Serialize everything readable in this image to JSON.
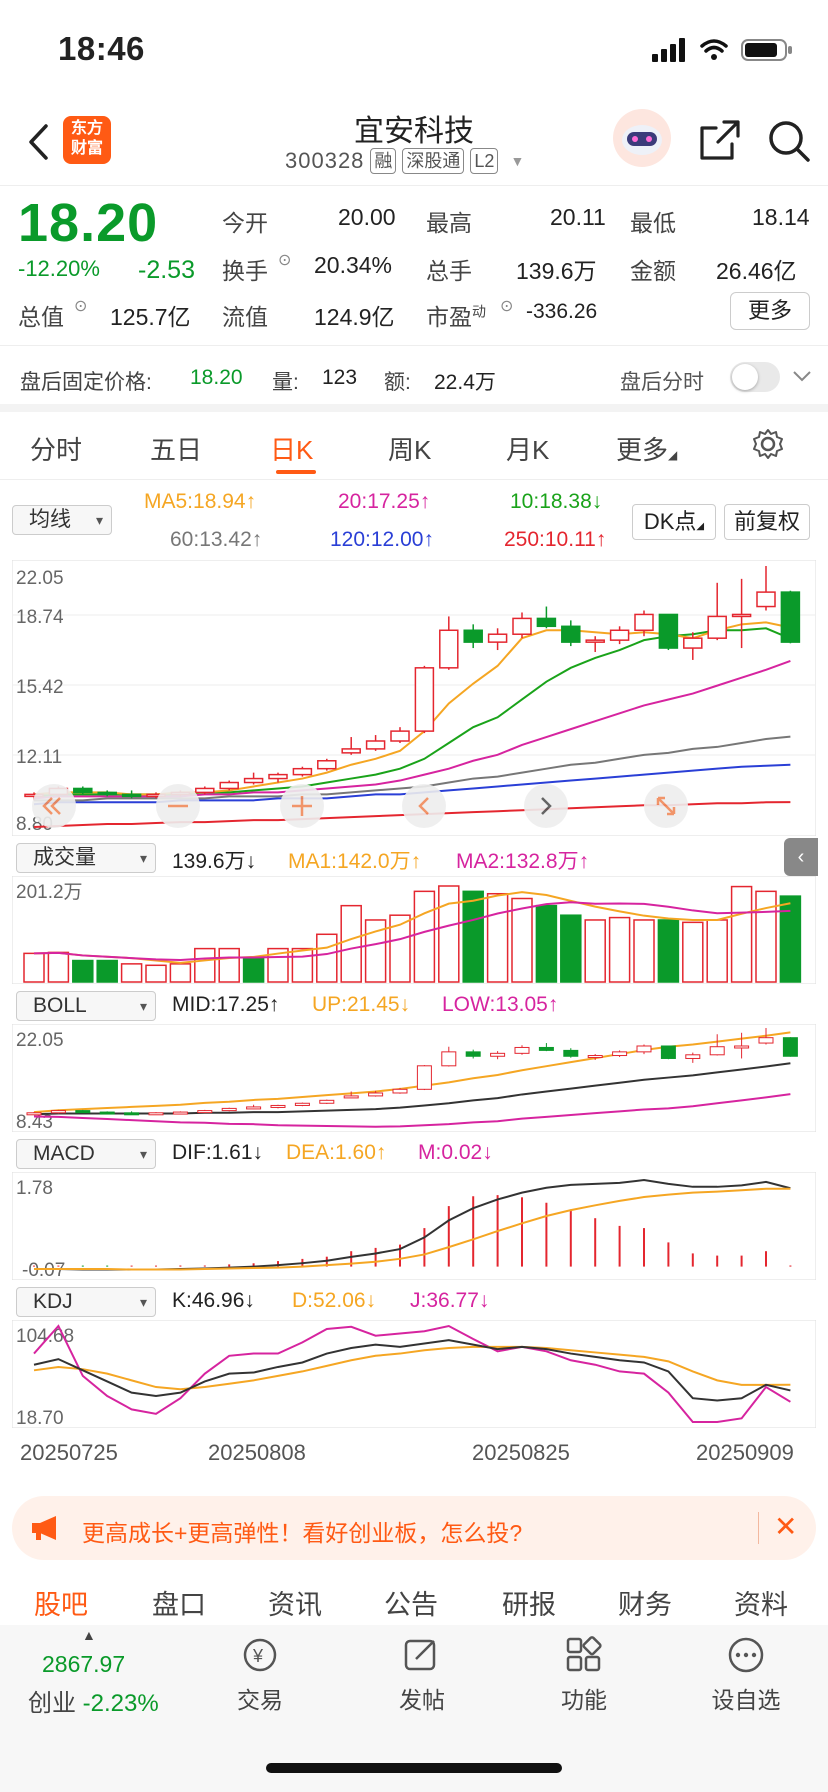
{
  "status": {
    "time": "18:46"
  },
  "header": {
    "title": "宜安科技",
    "code": "300328",
    "tags": [
      "融",
      "深股通",
      "L2"
    ],
    "logo_text": [
      "东方",
      "财富"
    ]
  },
  "quote": {
    "price": "18.20",
    "change_pct": "-12.20%",
    "change": "-2.53",
    "open_label": "今开",
    "open": "20.00",
    "high_label": "最高",
    "high": "20.11",
    "low_label": "最低",
    "low": "18.14",
    "turnover_label": "换手",
    "turnover": "20.34%",
    "volume_label": "总手",
    "volume": "139.6万",
    "amount_label": "金额",
    "amount": "26.46亿",
    "mcap_label": "总值",
    "mcap": "125.7亿",
    "float_label": "流值",
    "float": "124.9亿",
    "pe_label": "市盈",
    "pe_sup": "动",
    "pe": "-336.26",
    "more_label": "更多"
  },
  "after_hours": {
    "label": "盘后固定价格:",
    "price": "18.20",
    "vol_label": "量:",
    "vol": "123",
    "amt_label": "额:",
    "amt": "22.4万",
    "toggle_label": "盘后分时",
    "toggle_on": false
  },
  "tabs": [
    "分时",
    "五日",
    "日K",
    "周K",
    "月K",
    "更多"
  ],
  "active_tab": "日K",
  "ma": {
    "select": "均线",
    "ma5": "MA5:18.94",
    "ma20": "20:17.25",
    "ma10": "10:18.38",
    "ma60": "60:13.42",
    "ma120": "120:12.00",
    "ma250": "250:10.11",
    "dk": "DK点",
    "fq": "前复权",
    "colors": {
      "ma5": "#f5a623",
      "ma10": "#1aa31a",
      "ma20": "#d6249f",
      "ma60": "#777777",
      "ma120": "#2a3fd6",
      "ma250": "#e4262f"
    }
  },
  "k_axis": {
    "y1": "22.05",
    "y2": "18.74",
    "y3": "15.42",
    "y4": "12.11",
    "y5": "8.80"
  },
  "volume": {
    "select": "成交量",
    "total": "139.6万",
    "ma1": "MA1:142.0万",
    "ma2": "MA2:132.8万",
    "ymax": "201.2万"
  },
  "boll": {
    "select": "BOLL",
    "mid": "MID:17.25",
    "up": "UP:21.45",
    "low": "LOW:13.05",
    "ymax": "22.05",
    "ymin": "8.43"
  },
  "macd": {
    "select": "MACD",
    "dif": "DIF:1.61",
    "dea": "DEA:1.60",
    "m": "M:0.02",
    "ymax": "1.78",
    "ymin": "-0.07"
  },
  "kdj": {
    "select": "KDJ",
    "k": "K:46.96",
    "d": "D:52.06",
    "j": "J:36.77",
    "ymax": "104.68",
    "ymin": "18.70"
  },
  "dates": [
    "20250725",
    "20250808",
    "20250825",
    "20250909"
  ],
  "chart_data": {
    "type": "candlestick",
    "ohlc": [
      [
        10.4,
        10.6,
        10.2,
        10.5
      ],
      [
        10.5,
        10.9,
        10.4,
        10.8
      ],
      [
        10.8,
        10.9,
        10.5,
        10.6
      ],
      [
        10.6,
        10.7,
        10.4,
        10.5
      ],
      [
        10.5,
        10.7,
        10.3,
        10.4
      ],
      [
        10.4,
        10.6,
        10.3,
        10.5
      ],
      [
        10.5,
        10.7,
        10.4,
        10.6
      ],
      [
        10.6,
        10.9,
        10.5,
        10.8
      ],
      [
        10.8,
        11.2,
        10.7,
        11.1
      ],
      [
        11.1,
        11.6,
        11.0,
        11.3
      ],
      [
        11.3,
        11.6,
        11.1,
        11.5
      ],
      [
        11.5,
        11.9,
        11.4,
        11.8
      ],
      [
        11.8,
        12.3,
        11.7,
        12.2
      ],
      [
        12.6,
        13.4,
        12.5,
        12.8
      ],
      [
        12.8,
        13.5,
        12.7,
        13.2
      ],
      [
        13.2,
        13.9,
        13.1,
        13.7
      ],
      [
        13.7,
        17.0,
        13.6,
        16.9
      ],
      [
        16.9,
        19.5,
        16.8,
        18.8
      ],
      [
        18.8,
        19.1,
        17.9,
        18.2
      ],
      [
        18.2,
        18.9,
        17.8,
        18.6
      ],
      [
        18.6,
        19.7,
        18.4,
        19.4
      ],
      [
        19.4,
        20.0,
        18.9,
        19.0
      ],
      [
        19.0,
        19.3,
        18.0,
        18.2
      ],
      [
        18.2,
        18.5,
        17.7,
        18.3
      ],
      [
        18.3,
        19.0,
        18.1,
        18.8
      ],
      [
        18.8,
        19.8,
        18.5,
        19.6
      ],
      [
        19.6,
        19.6,
        17.8,
        17.9
      ],
      [
        17.9,
        18.7,
        17.3,
        18.4
      ],
      [
        18.4,
        21.2,
        18.3,
        19.5
      ],
      [
        19.5,
        21.4,
        17.9,
        19.6
      ],
      [
        20.0,
        22.05,
        19.8,
        20.73
      ],
      [
        20.73,
        20.8,
        18.14,
        18.2
      ]
    ],
    "ma5": [
      10.5,
      10.6,
      10.6,
      10.6,
      10.5,
      10.5,
      10.6,
      10.6,
      10.7,
      10.9,
      11.1,
      11.3,
      11.6,
      12.0,
      12.3,
      12.7,
      13.7,
      15.1,
      16.1,
      17.0,
      18.4,
      18.8,
      18.8,
      18.7,
      18.6,
      18.7,
      18.6,
      18.4,
      18.8,
      19.1,
      19.2,
      18.94
    ],
    "ma10": [
      10.4,
      10.5,
      10.5,
      10.5,
      10.5,
      10.5,
      10.5,
      10.6,
      10.6,
      10.7,
      10.8,
      10.9,
      11.1,
      11.3,
      11.5,
      11.8,
      12.3,
      13.1,
      13.9,
      14.4,
      15.3,
      16.2,
      16.9,
      17.4,
      17.8,
      18.3,
      18.5,
      18.6,
      18.8,
      18.8,
      18.9,
      18.38
    ],
    "ma20": [
      10.3,
      10.4,
      10.4,
      10.4,
      10.4,
      10.4,
      10.4,
      10.5,
      10.5,
      10.6,
      10.6,
      10.7,
      10.8,
      10.9,
      11.0,
      11.2,
      11.5,
      11.8,
      12.2,
      12.5,
      13.0,
      13.4,
      13.8,
      14.2,
      14.6,
      15.0,
      15.3,
      15.6,
      16.0,
      16.4,
      16.8,
      17.25
    ],
    "ma60": [
      10.2,
      10.2,
      10.2,
      10.3,
      10.3,
      10.3,
      10.3,
      10.3,
      10.4,
      10.4,
      10.4,
      10.5,
      10.5,
      10.6,
      10.7,
      10.8,
      10.9,
      11.1,
      11.3,
      11.4,
      11.6,
      11.8,
      12.0,
      12.1,
      12.3,
      12.5,
      12.6,
      12.8,
      12.9,
      13.1,
      13.3,
      13.42
    ],
    "ma120": [
      10.0,
      10.1,
      10.1,
      10.1,
      10.1,
      10.1,
      10.2,
      10.2,
      10.2,
      10.2,
      10.3,
      10.3,
      10.3,
      10.4,
      10.5,
      10.5,
      10.6,
      10.7,
      10.8,
      10.9,
      11.0,
      11.1,
      11.2,
      11.3,
      11.4,
      11.5,
      11.6,
      11.7,
      11.8,
      11.9,
      11.95,
      12.0
    ],
    "ma250": [
      8.85,
      8.9,
      8.95,
      9.0,
      9.0,
      9.05,
      9.1,
      9.1,
      9.15,
      9.2,
      9.2,
      9.25,
      9.3,
      9.35,
      9.4,
      9.45,
      9.5,
      9.55,
      9.6,
      9.65,
      9.7,
      9.75,
      9.8,
      9.85,
      9.9,
      9.95,
      9.95,
      10.0,
      10.05,
      10.05,
      10.1,
      10.11
    ],
    "volume": [
      60,
      62,
      45,
      45,
      38,
      35,
      38,
      70,
      70,
      50,
      70,
      70,
      100,
      160,
      130,
      140,
      190,
      201.2,
      190,
      185,
      175,
      160,
      140,
      130,
      135,
      130,
      130,
      125,
      130,
      200,
      190,
      180
    ],
    "volume_up": [
      true,
      true,
      false,
      false,
      true,
      true,
      true,
      true,
      true,
      false,
      true,
      true,
      true,
      true,
      true,
      true,
      true,
      true,
      false,
      true,
      true,
      false,
      false,
      true,
      true,
      true,
      false,
      true,
      true,
      true,
      true,
      false
    ],
    "macd_dif": [
      -0.05,
      -0.05,
      -0.06,
      -0.06,
      -0.06,
      -0.06,
      -0.05,
      -0.04,
      -0.02,
      0.0,
      0.03,
      0.07,
      0.12,
      0.2,
      0.27,
      0.36,
      0.6,
      0.95,
      1.2,
      1.38,
      1.52,
      1.62,
      1.68,
      1.7,
      1.72,
      1.78,
      1.7,
      1.64,
      1.64,
      1.67,
      1.74,
      1.61
    ],
    "macd_dea": [
      -0.05,
      -0.05,
      -0.05,
      -0.05,
      -0.06,
      -0.06,
      -0.06,
      -0.05,
      -0.04,
      -0.03,
      -0.02,
      0.0,
      0.03,
      0.06,
      0.1,
      0.16,
      0.25,
      0.4,
      0.56,
      0.73,
      0.89,
      1.04,
      1.16,
      1.26,
      1.35,
      1.43,
      1.48,
      1.52,
      1.54,
      1.57,
      1.6,
      1.6
    ],
    "kdj_k": [
      70,
      75,
      65,
      55,
      45,
      42,
      45,
      55,
      62,
      63,
      68,
      72,
      80,
      85,
      88,
      86,
      89,
      92,
      88,
      84,
      86,
      84,
      80,
      77,
      74,
      72,
      64,
      40,
      38,
      40,
      52,
      46.96
    ],
    "kdj_d": [
      65,
      68,
      66,
      62,
      56,
      50,
      48,
      50,
      53,
      56,
      60,
      64,
      69,
      74,
      78,
      80,
      83,
      85,
      86,
      86,
      86,
      85,
      83,
      81,
      79,
      77,
      73,
      64,
      56,
      52,
      52,
      52.06
    ],
    "kdj_j": [
      80,
      104.68,
      60,
      42,
      30,
      26,
      40,
      62,
      78,
      80,
      80,
      90,
      102,
      104,
      96,
      98,
      100,
      104.68,
      93,
      82,
      86,
      82,
      74,
      70,
      64,
      62,
      45,
      18.7,
      18.7,
      22,
      50,
      36.77
    ]
  }
}
